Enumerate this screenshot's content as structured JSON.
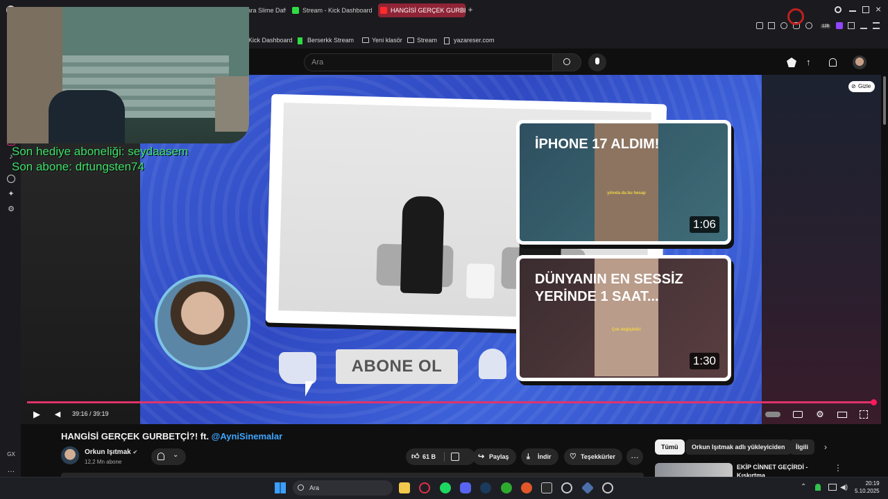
{
  "browser": {
    "tabs": [
      {
        "label": "Atara Slime Dafta",
        "active": false
      },
      {
        "label": "Stream - Kick Dashboard",
        "active": false
      },
      {
        "label": "HANGİSİ GERÇEK GURBE",
        "active": true
      }
    ],
    "new_tab_glyph": "+",
    "bookmarks": [
      {
        "label": "Kick Dashboard",
        "icon": "kick-icon"
      },
      {
        "label": "Berserkk Stream",
        "icon": "kick-icon"
      },
      {
        "label": "Yeni klasör",
        "icon": "folder-icon"
      },
      {
        "label": "Stream",
        "icon": "folder-icon"
      },
      {
        "label": "yazareser.com",
        "icon": "page-icon"
      }
    ],
    "badge_count": "128",
    "sidebar_bottom_label": "GX",
    "accent": "#8f2436"
  },
  "youtube": {
    "search_placeholder": "Ara",
    "hide_label": "Gizle"
  },
  "overlay": {
    "sub_gift_line": "Son hediye aboneliği: seydaasem",
    "sub_line": "Son abone: drtungsten74",
    "text_color": "#3ee06a"
  },
  "video_frame": {
    "subscribe_text": "ABONE OL",
    "card1": {
      "title": "İPHONE 17 ALDIM!",
      "caption": "yılında da bu hesap",
      "duration": "1:06"
    },
    "card2": {
      "title": "DÜNYANIN EN SESSİZ YERİNDE 1 SAAT...",
      "caption": "Çok değişiklik!",
      "duration": "1:30"
    }
  },
  "player": {
    "time": "39:16 / 39:19",
    "progress": 0.9987,
    "progress_color": "#e0336b"
  },
  "watch": {
    "title_main": "HANGİSİ GERÇEK GURBETÇİ?! ft. ",
    "title_mention": "@AyniSinemalar",
    "channel_name": "Orkun Işıtmak",
    "verified_glyph": "✔",
    "subscribers": "12,2 Mn abone",
    "like_count": "61 B",
    "share_label": "Paylaş",
    "download_label": "İndir",
    "thanks_label": "Teşekkürler",
    "more_glyph": "…"
  },
  "related": {
    "chips": [
      "Tümü",
      "Orkun Işıtmak adlı yükleyiciden",
      "İlgili"
    ],
    "item_title": "EKİP CİNNET GEÇİRDİ - Kışkırtma"
  },
  "taskbar": {
    "search_placeholder": "Ara",
    "time": "20:19",
    "date": "5.10.2025"
  }
}
